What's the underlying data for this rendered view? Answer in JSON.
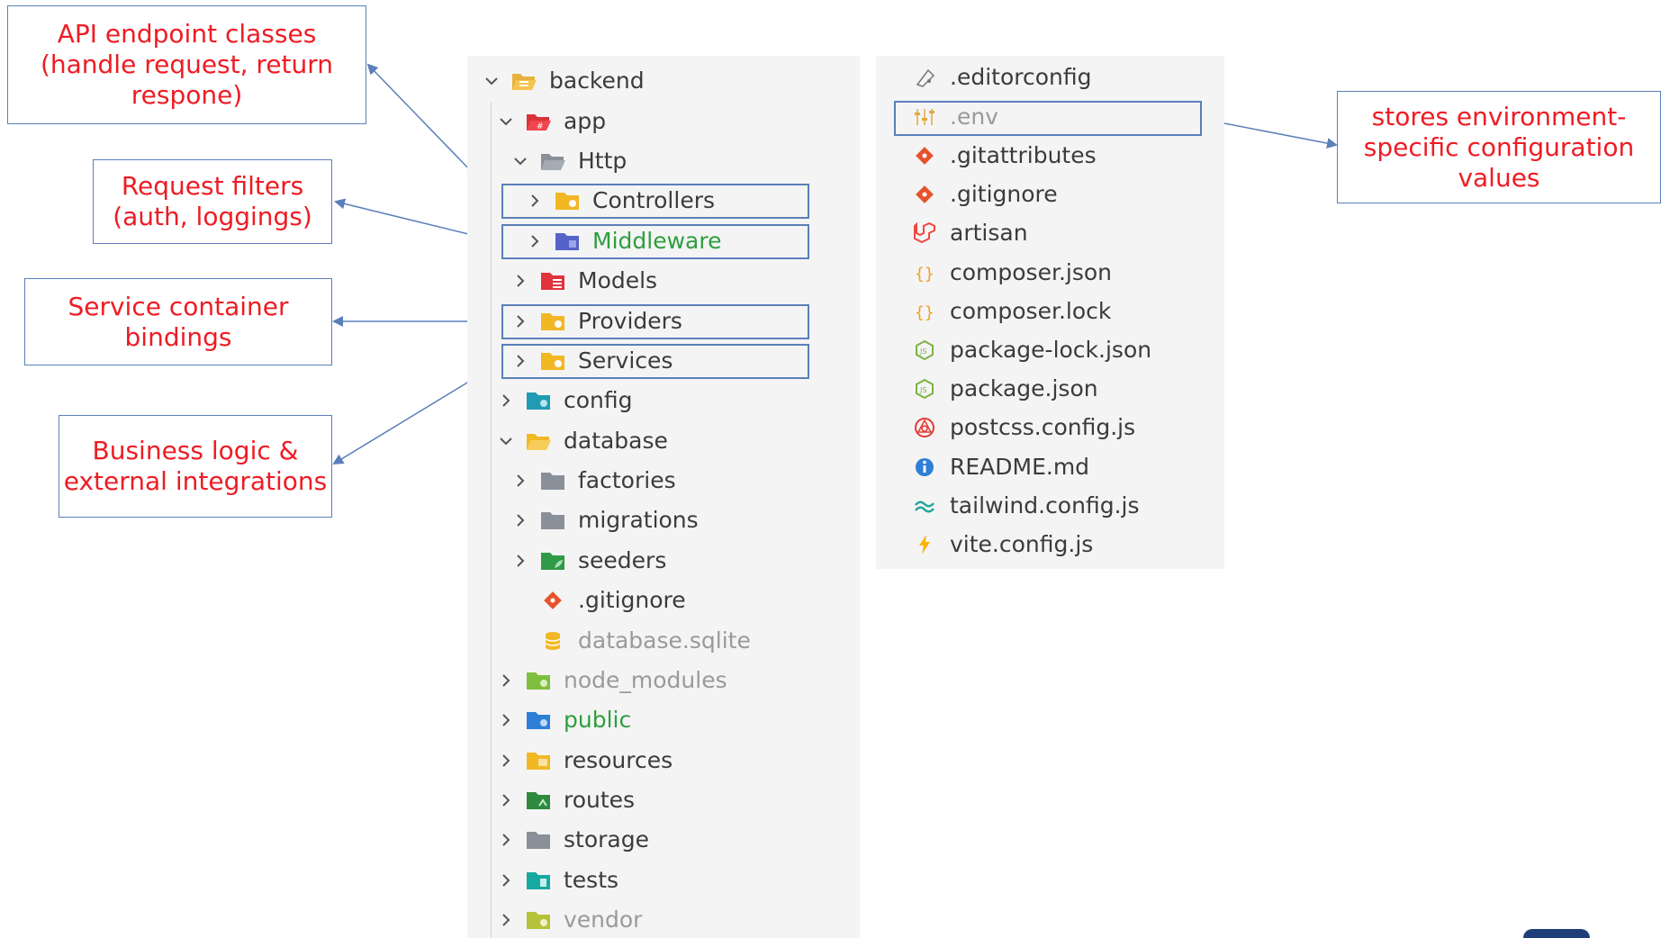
{
  "callouts": {
    "controllers": "API endpoint classes (handle request, return respone)",
    "middleware": "Request filters (auth, loggings)",
    "providers": "Service container bindings",
    "services": "Business logic & external integrations",
    "env": "stores environment-specific configuration values"
  },
  "tree": {
    "backend": "backend",
    "app": "app",
    "http": "Http",
    "controllers": "Controllers",
    "middleware": "Middleware",
    "models": "Models",
    "providers": "Providers",
    "services": "Services",
    "config": "config",
    "database": "database",
    "factories": "factories",
    "migrations": "migrations",
    "seeders": "seeders",
    "db_gitignore": ".gitignore",
    "database_sqlite": "database.sqlite",
    "node_modules": "node_modules",
    "public": "public",
    "resources": "resources",
    "routes": "routes",
    "storage": "storage",
    "tests": "tests",
    "vendor": "vendor"
  },
  "root_files": {
    "editorconfig": ".editorconfig",
    "env": ".env",
    "gitattributes": ".gitattributes",
    "gitignore": ".gitignore",
    "artisan": "artisan",
    "composer_json": "composer.json",
    "composer_lock": "composer.lock",
    "package_lock_json": "package-lock.json",
    "package_json": "package.json",
    "postcss_config": "postcss.config.js",
    "readme": "README.md",
    "tailwind_config": "tailwind.config.js",
    "vite_config": "vite.config.js"
  },
  "colors": {
    "callout_text": "#ee1c24",
    "box_border": "#5b7fb9",
    "panel_bg": "#f4f4f4",
    "dim_text": "#9a9a9a",
    "green_text": "#2e9e3f"
  },
  "icons": {
    "folder_open": "folder-open-icon",
    "folder_closed": "folder-icon",
    "git": "git-icon",
    "json": "json-braces-icon",
    "nodejs": "nodejs-icon",
    "info": "info-icon"
  }
}
